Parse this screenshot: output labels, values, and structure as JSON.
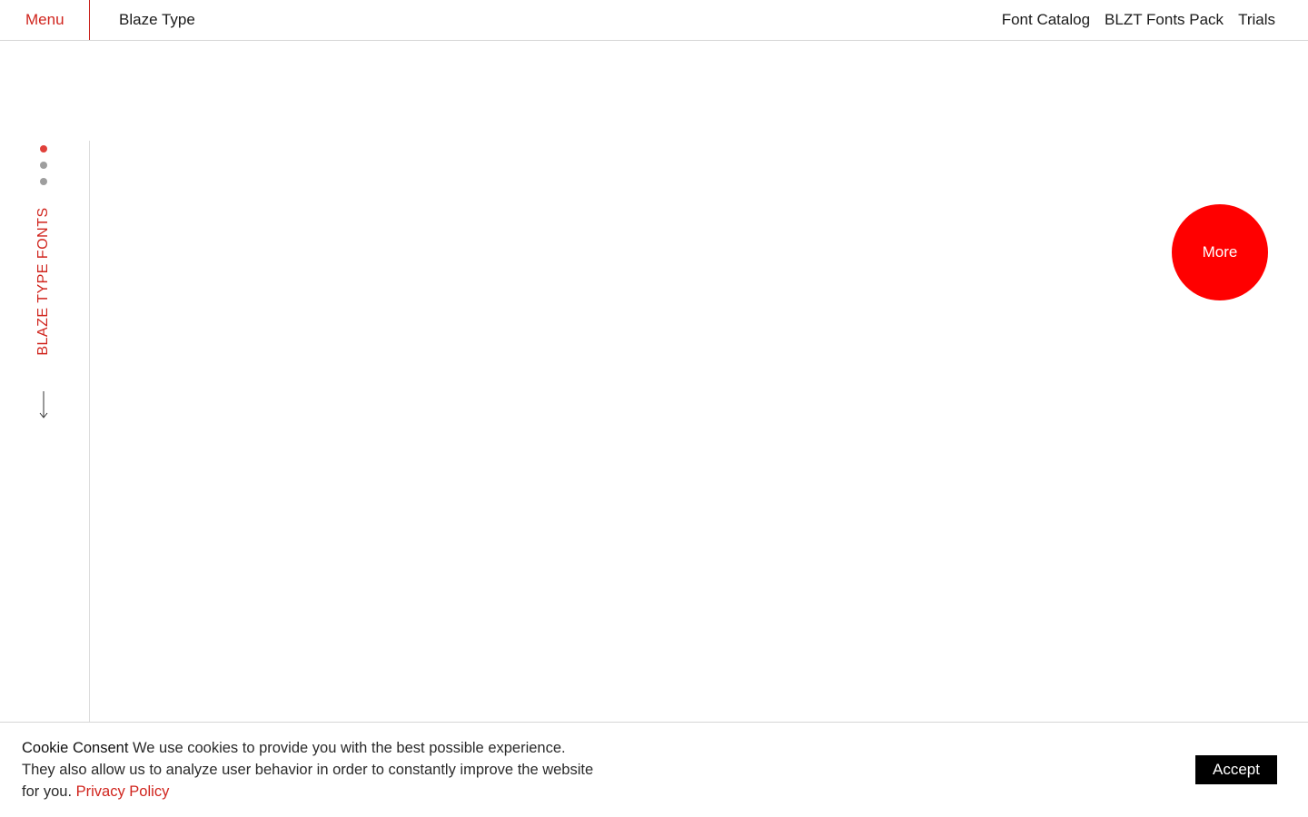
{
  "header": {
    "menu_label": "Menu",
    "brand": "Blaze Type",
    "nav": [
      {
        "label": "Font Catalog"
      },
      {
        "label": "BLZT Fonts Pack"
      },
      {
        "label": "Trials"
      }
    ]
  },
  "sidebar": {
    "vertical_label": "BLAZE TYPE FONTS",
    "slides": 3,
    "active_slide": 1,
    "arrow_icon": "arrow-down-icon"
  },
  "hero": {
    "more_label": "More"
  },
  "cookie": {
    "title": "Cookie Consent",
    "line1": " We use cookies to provide you with the best possible experience.",
    "line2": "They also allow us to analyze user behavior in order to constantly improve the website",
    "line3": "for you. ",
    "link": "Privacy Policy",
    "accept": "Accept"
  },
  "colors": {
    "accent": "#d0241d",
    "button_red": "#ff0000",
    "text": "#1a1a1a"
  }
}
